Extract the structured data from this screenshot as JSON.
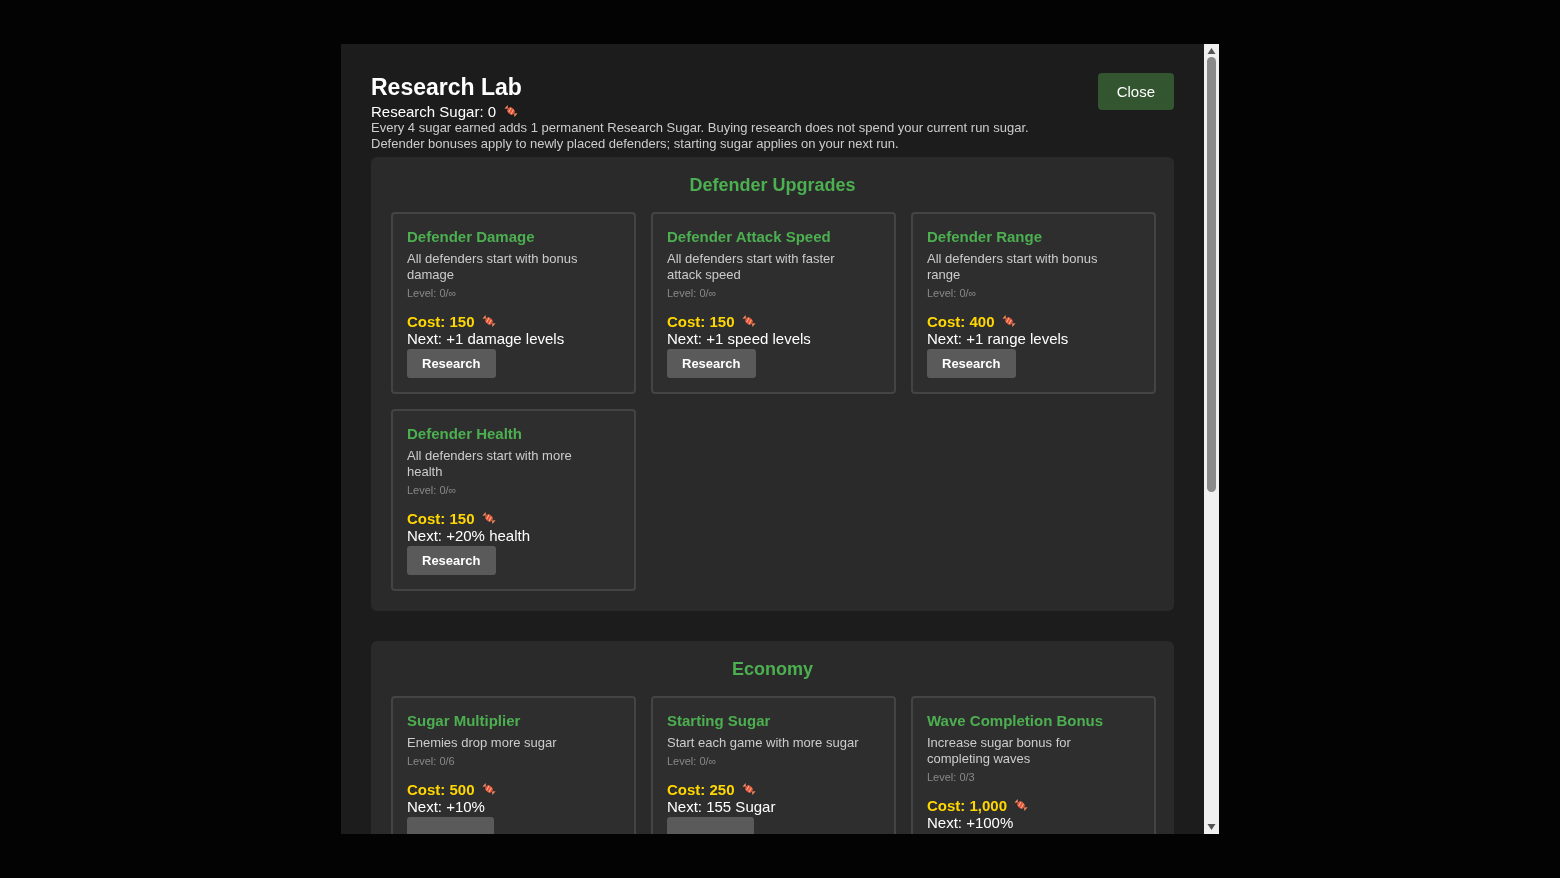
{
  "dialog": {
    "title": "Research Lab",
    "balance_label": "Research Sugar: 0",
    "notes": [
      "Every 4 sugar earned adds 1 permanent Research Sugar. Buying research does not spend your current run sugar.",
      "Defender bonuses apply to newly placed defenders; starting sugar applies on your next run."
    ],
    "close_button": "Close"
  },
  "sections": [
    {
      "title": "Defender Upgrades",
      "upgrades": [
        {
          "name": "Defender Damage",
          "description": "All defenders start with bonus damage",
          "level": "Level: 0/∞",
          "cost": "Cost: 150",
          "next": "Next: +1 damage levels",
          "button": "Research"
        },
        {
          "name": "Defender Attack Speed",
          "description": "All defenders start with faster attack speed",
          "level": "Level: 0/∞",
          "cost": "Cost: 150",
          "next": "Next: +1 speed levels",
          "button": "Research"
        },
        {
          "name": "Defender Range",
          "description": "All defenders start with bonus range",
          "level": "Level: 0/∞",
          "cost": "Cost: 400",
          "next": "Next: +1 range levels",
          "button": "Research"
        },
        {
          "name": "Defender Health",
          "description": "All defenders start with more health",
          "level": "Level: 0/∞",
          "cost": "Cost: 150",
          "next": "Next: +20% health",
          "button": "Research"
        }
      ]
    },
    {
      "title": "Economy",
      "upgrades": [
        {
          "name": "Sugar Multiplier",
          "description": "Enemies drop more sugar",
          "level": "Level: 0/6",
          "cost": "Cost: 500",
          "next": "Next: +10%",
          "button_clipped": true
        },
        {
          "name": "Starting Sugar",
          "description": "Start each game with more sugar",
          "level": "Level: 0/∞",
          "cost": "Cost: 250",
          "next": "Next: 155 Sugar",
          "button_clipped": true
        },
        {
          "name": "Wave Completion Bonus",
          "description": "Increase sugar bonus for completing waves",
          "level": "Level: 0/3",
          "cost": "Cost: 1,000",
          "next": "Next: +100%"
        }
      ]
    }
  ]
}
